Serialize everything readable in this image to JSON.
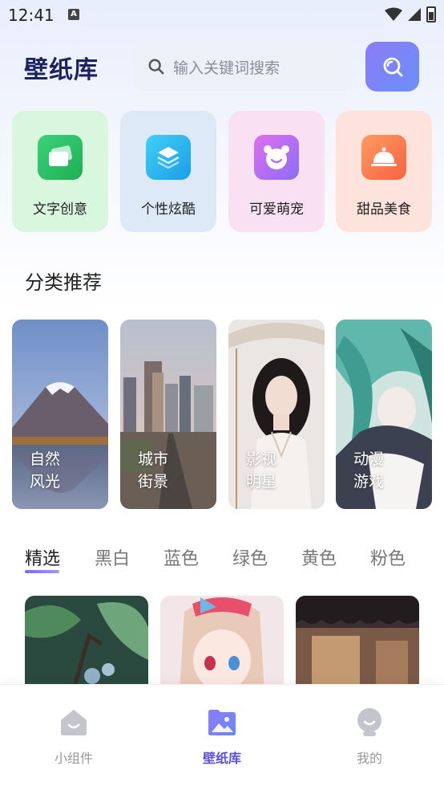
{
  "status": {
    "time": "12:41",
    "notif": "A"
  },
  "header": {
    "title": "壁纸库",
    "search_placeholder": "输入关键词搜索"
  },
  "categories": [
    {
      "label": "文字创意",
      "bg": "#d9f6df",
      "icon_bg": "#2fc46a",
      "icon": "cards-icon"
    },
    {
      "label": "个性炫酷",
      "bg": "#dde9f7",
      "icon_bg": "#2ab6f0",
      "icon": "layers-icon"
    },
    {
      "label": "可爱萌宠",
      "bg": "#f9e0f3",
      "icon_bg": "#b96bf2",
      "icon": "bear-icon"
    },
    {
      "label": "甜品美食",
      "bg": "#fde3dc",
      "icon_bg": "#fb7a4e",
      "icon": "dish-icon"
    }
  ],
  "section": {
    "title": "分类推荐"
  },
  "recommend": [
    {
      "label": "自然\n风光"
    },
    {
      "label": "城市\n街景"
    },
    {
      "label": "影视\n明星"
    },
    {
      "label": "动漫\n游戏"
    }
  ],
  "tabs": [
    "精选",
    "黑白",
    "蓝色",
    "绿色",
    "黄色",
    "粉色"
  ],
  "nav": [
    {
      "label": "小组件",
      "icon": "widget-icon"
    },
    {
      "label": "壁纸库",
      "icon": "gallery-icon"
    },
    {
      "label": "我的",
      "icon": "profile-icon"
    }
  ],
  "colors": {
    "accent": "#6b6cf2",
    "title": "#1d2260"
  }
}
